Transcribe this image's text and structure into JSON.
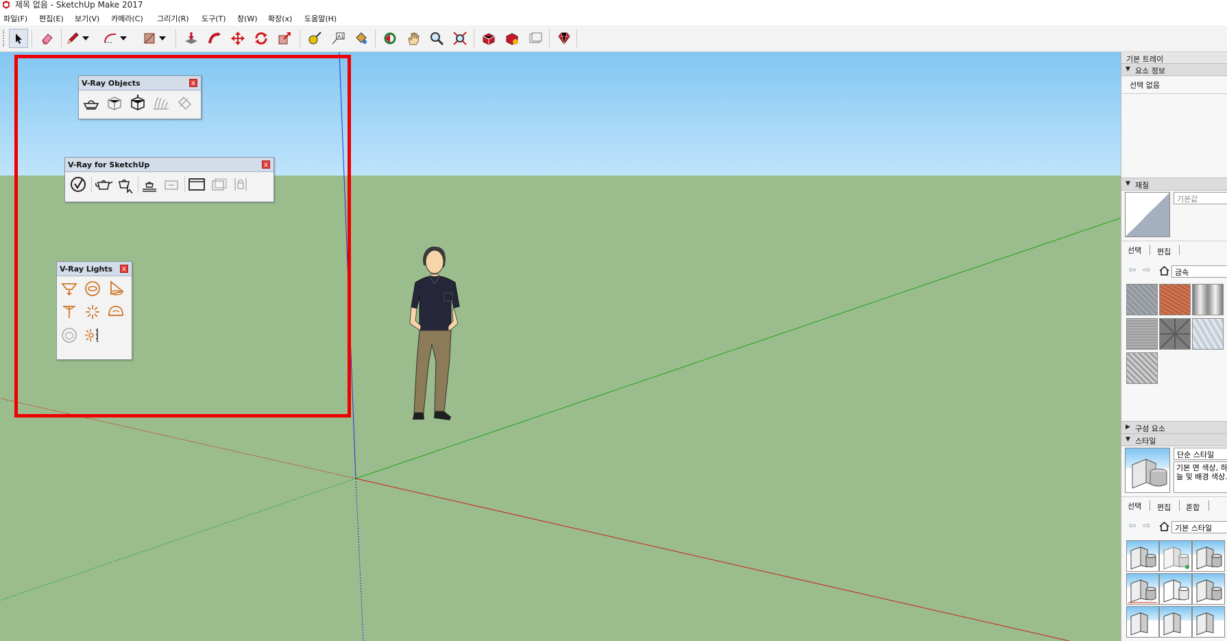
{
  "window": {
    "title": "제목 없음 - SketchUp Make 2017"
  },
  "menu": [
    {
      "label": "파일(F)"
    },
    {
      "label": "편집(E)"
    },
    {
      "label": "보기(V)"
    },
    {
      "label": "카메라(C)"
    },
    {
      "label": "그리기(R)"
    },
    {
      "label": "도구(T)"
    },
    {
      "label": "창(W)"
    },
    {
      "label": "확장(x)"
    },
    {
      "label": "도움말(H)"
    }
  ],
  "toolbar": {
    "tools": [
      "select-icon",
      "eraser-icon",
      "pencil-icon",
      "arc-icon",
      "rectangle-icon",
      "push-pull-icon",
      "follow-me-icon",
      "move-icon",
      "rotate-icon",
      "scale-icon",
      "tape-measure-icon",
      "text-icon",
      "paint-bucket-icon",
      "orbit-icon",
      "pan-icon",
      "zoom-icon",
      "zoom-extents-icon",
      "warehouse-icon",
      "extension-warehouse-icon",
      "layout-icon",
      "ruby-icon"
    ]
  },
  "palettes": {
    "objects": {
      "title": "V-Ray Objects",
      "close": "x"
    },
    "sketchup": {
      "title": "V-Ray for SketchUp",
      "close": "x"
    },
    "lights": {
      "title": "V-Ray Lights",
      "close": "x"
    }
  },
  "tray": {
    "title": "기본 트레이",
    "entity_info": {
      "header": "요소 정보",
      "status": "선택 없음"
    },
    "materials": {
      "header": "재질",
      "name": "기본값",
      "tabs": [
        "선택",
        "편집"
      ],
      "library": "금속"
    },
    "components": {
      "header": "구성 요소"
    },
    "styles": {
      "header": "스타일",
      "name": "단순 스타일",
      "description": "기본 면 색상, 하늘 및 배경 색상.",
      "tabs": [
        "선택",
        "편집",
        "혼합"
      ],
      "library": "기본 스타일"
    }
  },
  "colors": {
    "sky": "#82c6f2",
    "ground": "#9bbd8d",
    "highlight_box": "#ee0000",
    "axis_red": "#c8201c",
    "axis_green": "#1fa31f",
    "axis_blue": "#2233cc"
  }
}
